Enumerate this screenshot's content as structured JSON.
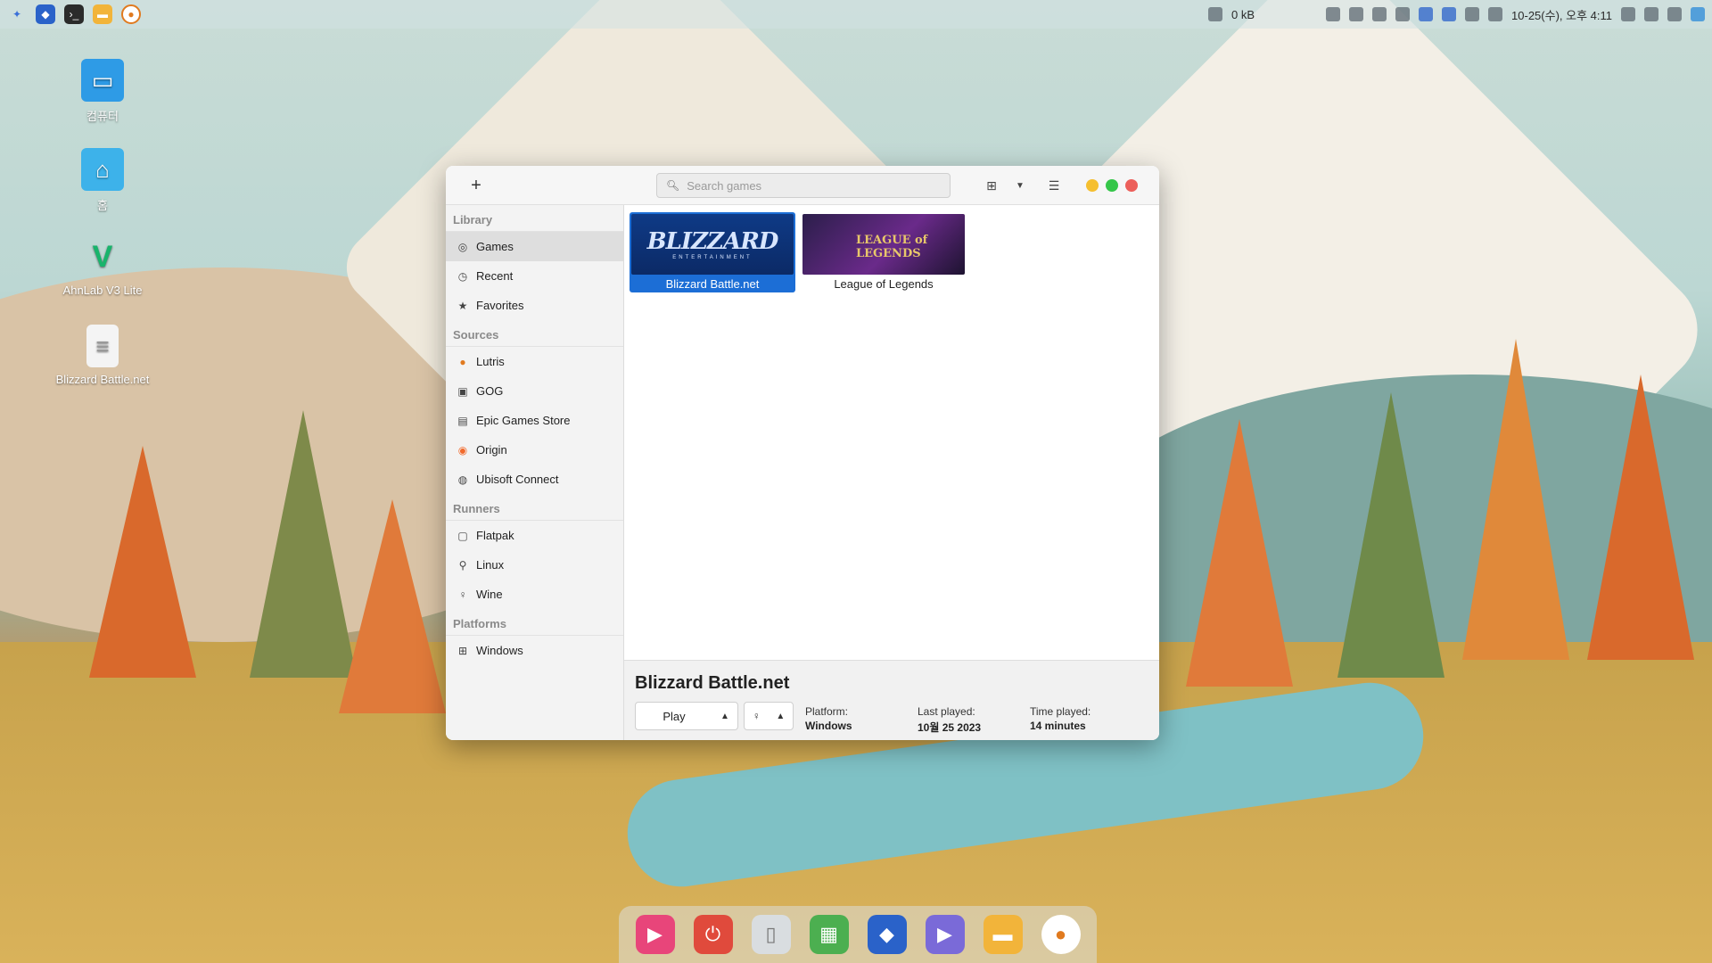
{
  "desktop": {
    "icons": [
      {
        "label": "컴퓨터",
        "icon": "computer-icon"
      },
      {
        "label": "홈",
        "icon": "home-folder-icon"
      },
      {
        "label": "AhnLab V3 Lite",
        "icon": "ahnlab-icon"
      },
      {
        "label": "Blizzard Battle.net",
        "icon": "file-icon"
      }
    ]
  },
  "topbar": {
    "net_speed": "0 kB",
    "datetime": "10-25(수), 오후 4:11"
  },
  "window": {
    "search_placeholder": "Search games",
    "add_symbol": "+",
    "sidebar": {
      "library_header": "Library",
      "library_items": [
        {
          "label": "Games",
          "icon": "gamepad-icon"
        },
        {
          "label": "Recent",
          "icon": "clock-icon"
        },
        {
          "label": "Favorites",
          "icon": "star-icon"
        }
      ],
      "sources_header": "Sources",
      "source_items": [
        {
          "label": "Lutris",
          "icon": "lutris-icon"
        },
        {
          "label": "GOG",
          "icon": "gog-icon"
        },
        {
          "label": "Epic Games Store",
          "icon": "epic-icon"
        },
        {
          "label": "Origin",
          "icon": "origin-icon"
        },
        {
          "label": "Ubisoft Connect",
          "icon": "ubisoft-icon"
        }
      ],
      "runners_header": "Runners",
      "runner_items": [
        {
          "label": "Flatpak",
          "icon": "flatpak-icon"
        },
        {
          "label": "Linux",
          "icon": "linux-icon"
        },
        {
          "label": "Wine",
          "icon": "wine-icon"
        }
      ],
      "platforms_header": "Platforms",
      "platform_items": [
        {
          "label": "Windows",
          "icon": "windows-icon"
        }
      ]
    },
    "games": [
      {
        "title": "Blizzard Battle.net",
        "selected": true
      },
      {
        "title": "League of Legends",
        "selected": false
      }
    ],
    "banner_text": {
      "blizzard_logo": "BLIZZARD",
      "blizzard_sub": "ENTERTAINMENT",
      "lol_logo": "LEAGUE of LEGENDS"
    },
    "details": {
      "title": "Blizzard Battle.net",
      "play_label": "Play",
      "platform_label": "Platform:",
      "platform_value": "Windows",
      "last_played_label": "Last played:",
      "last_played_value": "10월 25 2023",
      "time_played_label": "Time played:",
      "time_played_value": "14 minutes"
    }
  },
  "colors": {
    "selection": "#1c6ed6",
    "close": "#ec5f5a",
    "minimize": "#f5bf2f",
    "maximize": "#35c649"
  }
}
